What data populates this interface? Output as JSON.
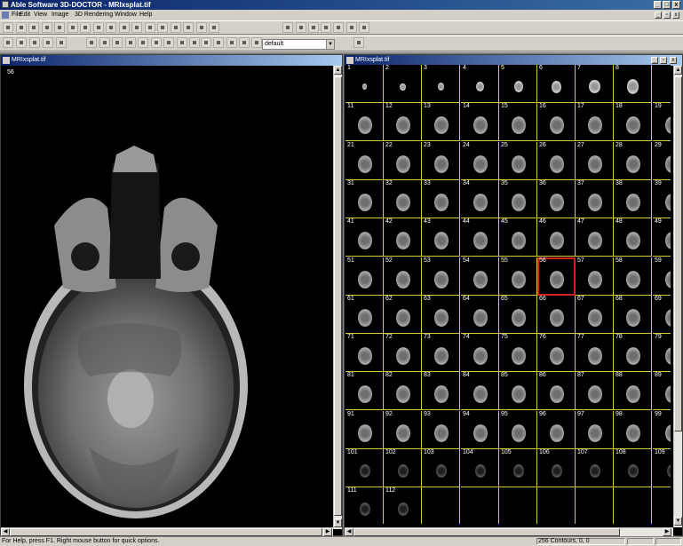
{
  "window": {
    "title": "Able Software 3D-DOCTOR - MRIxsplat.tif",
    "controls": [
      "_",
      "□",
      "x"
    ]
  },
  "menu": {
    "items": [
      "File",
      "Edit",
      "View",
      "Image",
      "3D Rendering",
      "Window",
      "Help"
    ]
  },
  "toolbar": {
    "render_mode": "default"
  },
  "left_window": {
    "title": "MRIxsplat.tif",
    "slice_number": "56"
  },
  "right_window": {
    "title": "MRIxsplat.tif"
  },
  "thumbnails": {
    "selected": 56,
    "rows": [
      [
        "1",
        "2",
        "3",
        "4",
        "5",
        "6",
        "7",
        "8",
        ""
      ],
      [
        "11",
        "12",
        "13",
        "14",
        "15",
        "16",
        "17",
        "18",
        "19"
      ],
      [
        "21",
        "22",
        "23",
        "24",
        "25",
        "26",
        "27",
        "28",
        "29"
      ],
      [
        "31",
        "32",
        "33",
        "34",
        "35",
        "36",
        "37",
        "38",
        "39"
      ],
      [
        "41",
        "42",
        "43",
        "44",
        "45",
        "46",
        "47",
        "48",
        "49"
      ],
      [
        "51",
        "52",
        "53",
        "54",
        "55",
        "56",
        "57",
        "58",
        "59"
      ],
      [
        "61",
        "62",
        "63",
        "64",
        "65",
        "66",
        "67",
        "68",
        "69"
      ],
      [
        "71",
        "72",
        "73",
        "74",
        "75",
        "76",
        "77",
        "78",
        "79"
      ],
      [
        "81",
        "82",
        "83",
        "84",
        "85",
        "86",
        "87",
        "88",
        "89"
      ],
      [
        "91",
        "92",
        "93",
        "94",
        "95",
        "96",
        "97",
        "98",
        "99"
      ],
      [
        "101",
        "102",
        "103",
        "104",
        "105",
        "106",
        "107",
        "108",
        "109"
      ],
      [
        "111",
        "112",
        "",
        "",
        "",
        "",
        "",
        "",
        ""
      ]
    ]
  },
  "status": {
    "left": "For Help, press F1. Right mouse button for quick options.",
    "right": "256 Contours, 0, 0"
  }
}
